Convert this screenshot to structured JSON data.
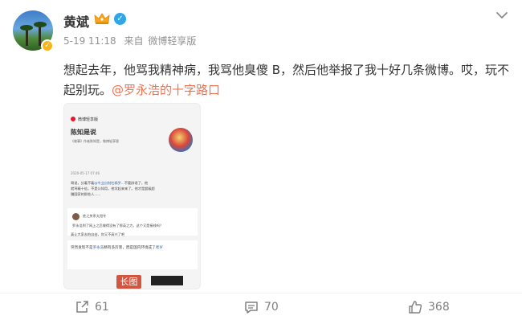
{
  "post": {
    "author": "黄斌",
    "time": "5-19 11:18",
    "source_prefix": "来自",
    "source": "微博轻享版",
    "text_main": "想起去年，他骂我精神病，我骂他臭傻 B，然后他举报了我十好几条微博。哎，玩不起别玩。",
    "mention": "@罗永浩的十字路口",
    "image_badge": "长图"
  },
  "thumbnail": {
    "app": "微博轻享版",
    "name": "陈知是说",
    "desc": "《故事》作者陈知是，微博轻享版",
    "date": "2020-05-17 07:46",
    "line1": "哥说，分着不着",
    "line1_link": "@专业自制杠精罗...",
    "line1_rest": "不要辟谣了，他",
    "line2": "就骂精十倍，不是公知用，他学起来来了。他才是超级超",
    "line3": "赚国家的那些人......",
    "comment_user": "姓之关系太阳冬",
    "comment_text": "罗永浩到了网上之后做得没有了那英之力，这个又是接线吗？",
    "comment2": "真让大家去拍自由，你又不高兴了吧",
    "reply_text": "突然发现不是",
    "reply_link": "罗永浩",
    "reply_rest": "精有多厉害，而是国内环境成了",
    "reply_tail": "者岁"
  },
  "actions": {
    "repost_count": "61",
    "comment_count": "70",
    "like_count": "368"
  },
  "colors": {
    "mention": "#eb7350",
    "meta": "#939393",
    "badge": "#d4553f"
  },
  "icons": [
    "crown-icon",
    "verified-icon",
    "chevron-down-icon",
    "repost-icon",
    "comment-icon",
    "like-icon"
  ]
}
